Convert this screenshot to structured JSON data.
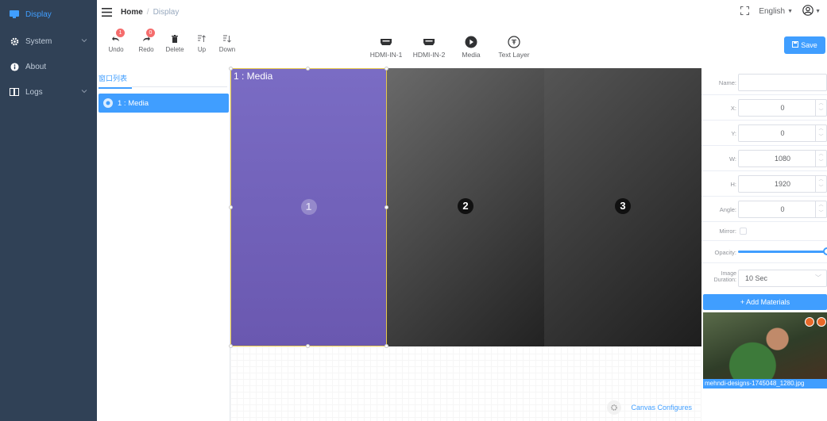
{
  "sidebar": {
    "items": [
      {
        "label": "Display",
        "icon": "monitor-icon",
        "active": true
      },
      {
        "label": "System",
        "icon": "gear-icon",
        "chevron": true
      },
      {
        "label": "About",
        "icon": "info-icon"
      },
      {
        "label": "Logs",
        "icon": "book-icon",
        "chevron": true
      }
    ]
  },
  "header": {
    "breadcrumb_home": "Home",
    "breadcrumb_sep": "/",
    "breadcrumb_current": "Display",
    "language": "English"
  },
  "toolbar": {
    "undo": {
      "label": "Undo",
      "badge": "1"
    },
    "redo": {
      "label": "Redo",
      "badge": "0"
    },
    "delete": "Delete",
    "up": "Up",
    "down": "Down",
    "sources": [
      "HDMI-IN-1",
      "HDMI-IN-2",
      "Media",
      "Text Layer"
    ],
    "save": "Save"
  },
  "window_list": {
    "tab": "窗口列表",
    "items": [
      {
        "label": "1 : Media"
      }
    ]
  },
  "canvas": {
    "window_label": "1 : Media",
    "screens": [
      "1",
      "2",
      "3"
    ],
    "configure": "Canvas Configures"
  },
  "properties": {
    "name_label": "Name:",
    "name_value": "",
    "x_label": "X:",
    "x_value": "0",
    "y_label": "Y:",
    "y_value": "0",
    "w_label": "W:",
    "w_value": "1080",
    "h_label": "H:",
    "h_value": "1920",
    "angle_label": "Angle:",
    "angle_value": "0",
    "mirror_label": "Mirror:",
    "opacity_label": "Opacity:",
    "opacity_value": 1.0,
    "duration_label": "Image Duration:",
    "duration_value": "10 Sec",
    "add_materials": "+ Add Materials",
    "material_file": "mehndi-designs-1745048_1280.jpg"
  },
  "colors": {
    "sidebar_bg": "#304156",
    "accent": "#409eff",
    "badge": "#f56c6c"
  }
}
